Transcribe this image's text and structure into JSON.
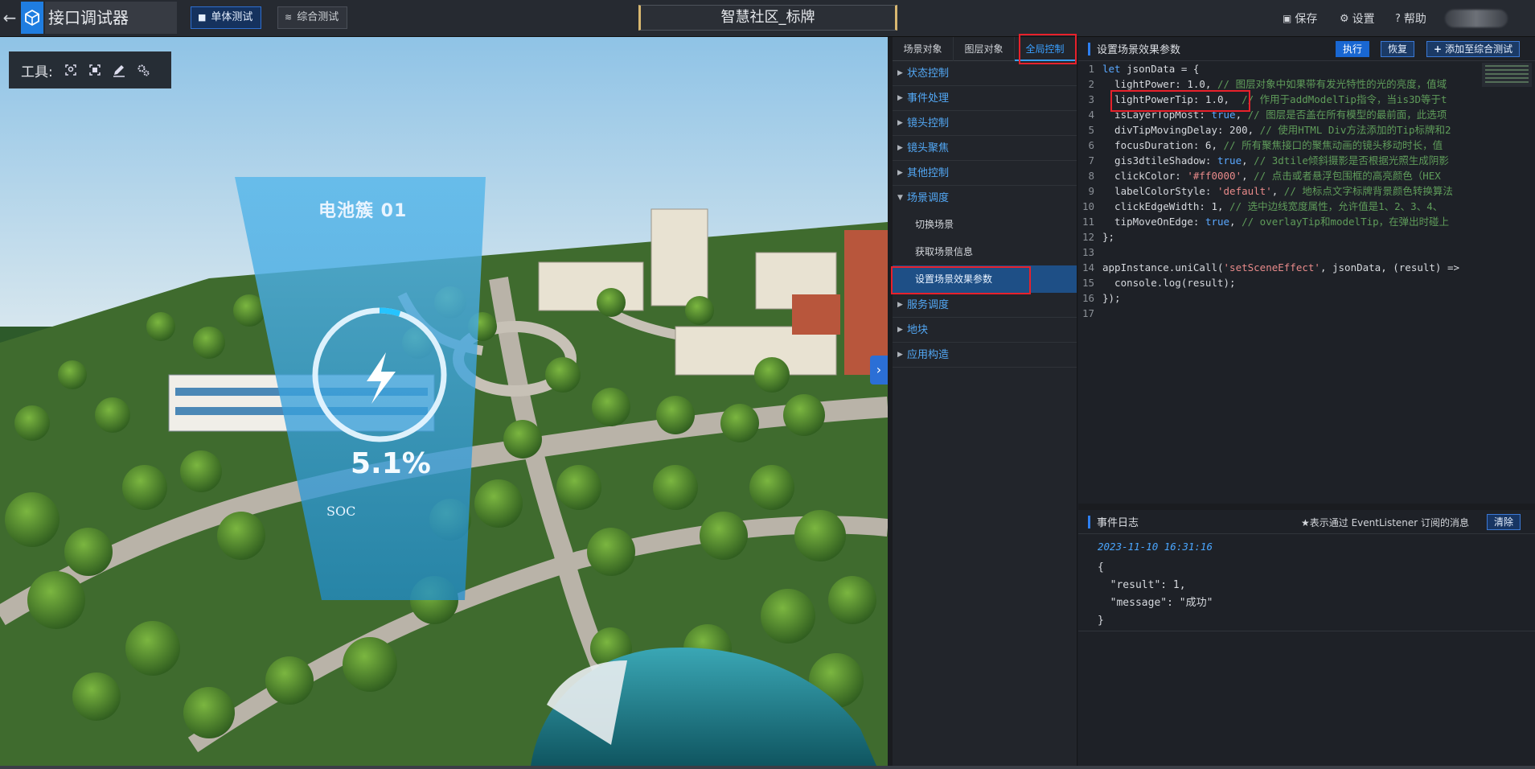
{
  "header": {
    "app_title": "接口调试器",
    "tab_single": "单体测试",
    "tab_combined": "综合测试",
    "project_title": "智慧社区_标牌",
    "save": "保存",
    "settings": "设置",
    "help": "帮助"
  },
  "viewport": {
    "tools_label": "工具:",
    "hud_title": "电池簇  01",
    "hud_percent": "5.1%",
    "hud_soc": "SOC",
    "soc_progress_percent": 5.1
  },
  "left_panel": {
    "tabs": [
      {
        "label": "场景对象"
      },
      {
        "label": "图层对象"
      },
      {
        "label": "全局控制"
      }
    ],
    "tree": [
      {
        "label": "状态控制"
      },
      {
        "label": "事件处理"
      },
      {
        "label": "镜头控制"
      },
      {
        "label": "镜头聚焦"
      },
      {
        "label": "其他控制"
      },
      {
        "label": "场景调度",
        "children": [
          {
            "label": "切换场景"
          },
          {
            "label": "获取场景信息"
          },
          {
            "label": "设置场景效果参数"
          }
        ]
      },
      {
        "label": "服务调度"
      },
      {
        "label": "地块"
      },
      {
        "label": "应用构造"
      }
    ]
  },
  "code_panel": {
    "title": "设置场景效果参数",
    "run": "执行",
    "restore": "恢复",
    "add_to_combined": "添加至综合测试",
    "lines": [
      {
        "n": "1",
        "text": "let jsonData = {"
      },
      {
        "n": "2",
        "text": "  lightPower: 1.0, // 图层对象中如果带有发光特性的光的亮度，值域"
      },
      {
        "n": "3",
        "text": "  lightPowerTip: 1.0,  // 作用于addModelTip指令，当is3D等于t"
      },
      {
        "n": "4",
        "text": "  isLayerTopMost: true, // 图层是否盖在所有模型的最前面，此选项"
      },
      {
        "n": "5",
        "text": "  divTipMovingDelay: 200, // 使用HTML Div方法添加的Tip标牌和2"
      },
      {
        "n": "6",
        "text": "  focusDuration: 6, // 所有聚焦接口的聚焦动画的镜头移动时长，值"
      },
      {
        "n": "7",
        "text": "  gis3dtileShadow: true, // 3dtile倾斜摄影是否根据光照生成阴影"
      },
      {
        "n": "8",
        "text": "  clickColor: '#ff0000', // 点击或者悬浮包围框的高亮颜色（HEX"
      },
      {
        "n": "9",
        "text": "  labelColorStyle: 'default', // 地标点文字标牌背景颜色转换算法"
      },
      {
        "n": "10",
        "text": "  clickEdgeWidth: 1, // 选中边线宽度属性，允许值是1、2、3、4、"
      },
      {
        "n": "11",
        "text": "  tipMoveOnEdge: true, // overlayTip和modelTip，在弹出时碰上"
      },
      {
        "n": "12",
        "text": "};"
      },
      {
        "n": "13",
        "text": ""
      },
      {
        "n": "14",
        "text": "appInstance.uniCall('setSceneEffect', jsonData, (result) =>"
      },
      {
        "n": "15",
        "text": "  console.log(result);"
      },
      {
        "n": "16",
        "text": "});"
      },
      {
        "n": "17",
        "text": ""
      }
    ]
  },
  "event_panel": {
    "title": "事件日志",
    "hint": "★表示通过 EventListener 订阅的消息",
    "clear": "清除",
    "timestamp": "2023-11-10 16:31:16",
    "log_lines": [
      "{",
      "  \"result\": 1,",
      "  \"message\": \"成功\"",
      "}"
    ]
  },
  "colors": {
    "accent": "#1967d2",
    "highlight_box": "#e8212b",
    "tree_link": "#53a8f5",
    "selected_item": "#1e4f86"
  }
}
